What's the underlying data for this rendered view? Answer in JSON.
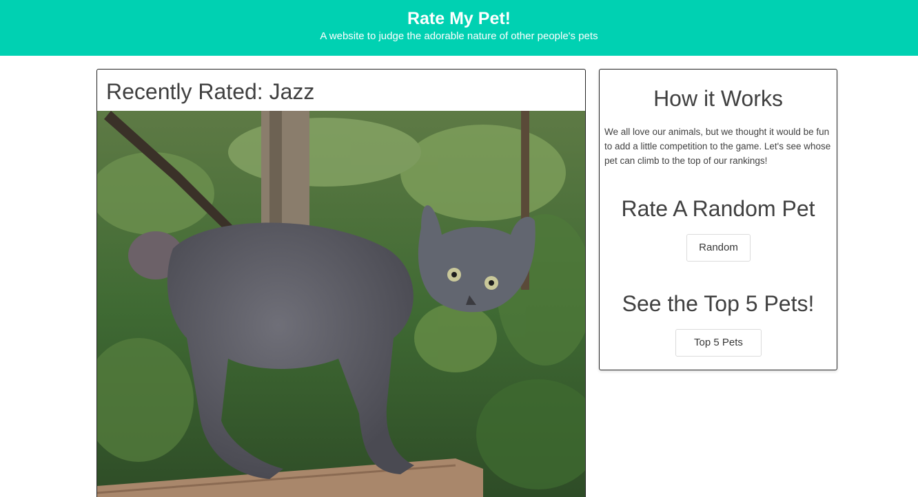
{
  "header": {
    "title": "Rate My Pet!",
    "subtitle": "A website to judge the adorable nature of other people's pets",
    "background": "#00d1b2"
  },
  "recent": {
    "title": "Recently Rated: Jazz",
    "photo_alt": "Jazz"
  },
  "how_it_works": {
    "heading": "How it Works",
    "text": "We all love our animals, but we thought it would be fun to add a little competition to the game. Let's see whose pet can climb to the top of our rankings!"
  },
  "random": {
    "heading": "Rate A Random Pet",
    "button_label": "Random"
  },
  "top5": {
    "heading": "See the Top 5 Pets!",
    "button_label": "Top 5 Pets"
  }
}
